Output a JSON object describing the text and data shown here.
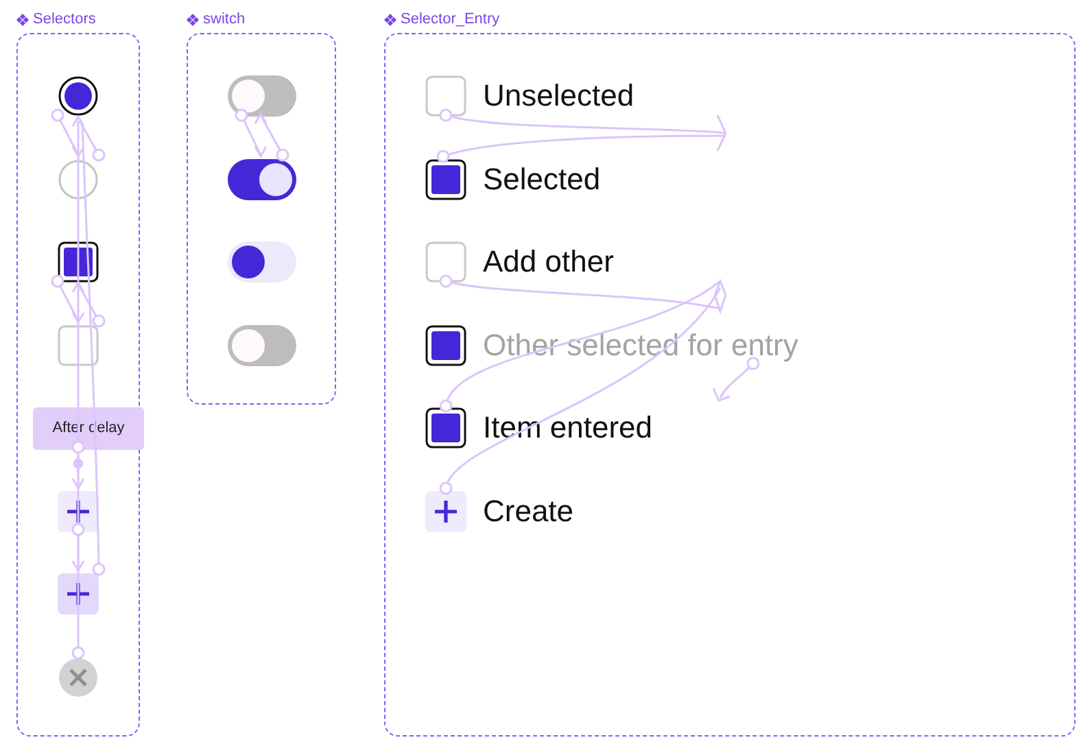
{
  "frames": [
    {
      "title": "Selectors",
      "items": [
        {
          "kind": "radio",
          "selected": true
        },
        {
          "kind": "radio",
          "selected": false
        },
        {
          "kind": "checkbox",
          "selected": true
        },
        {
          "kind": "checkbox",
          "selected": false
        },
        {
          "kind": "delay",
          "label": "After delay"
        },
        {
          "kind": "add",
          "highlighted": false
        },
        {
          "kind": "add",
          "highlighted": true
        },
        {
          "kind": "remove"
        }
      ]
    },
    {
      "title": "switch",
      "items": [
        {
          "kind": "switch",
          "on": false,
          "pressed": false
        },
        {
          "kind": "switch",
          "on": true,
          "pressed": false
        },
        {
          "kind": "switch",
          "on": false,
          "pressed": true
        },
        {
          "kind": "switch",
          "on": false,
          "pressed": false
        }
      ]
    },
    {
      "title": "Selector_Entry",
      "items": [
        {
          "kind": "checkbox",
          "selected": false,
          "label": "Unselected",
          "muted": false
        },
        {
          "kind": "checkbox",
          "selected": true,
          "label": "Selected",
          "muted": false
        },
        {
          "kind": "checkbox",
          "selected": false,
          "label": "Add other",
          "muted": false
        },
        {
          "kind": "checkbox",
          "selected": true,
          "label": "Other selected for entry",
          "muted": true
        },
        {
          "kind": "checkbox",
          "selected": true,
          "label": "Item entered",
          "muted": false
        },
        {
          "kind": "add",
          "highlighted": false,
          "label": "Create",
          "muted": false
        }
      ]
    }
  ]
}
